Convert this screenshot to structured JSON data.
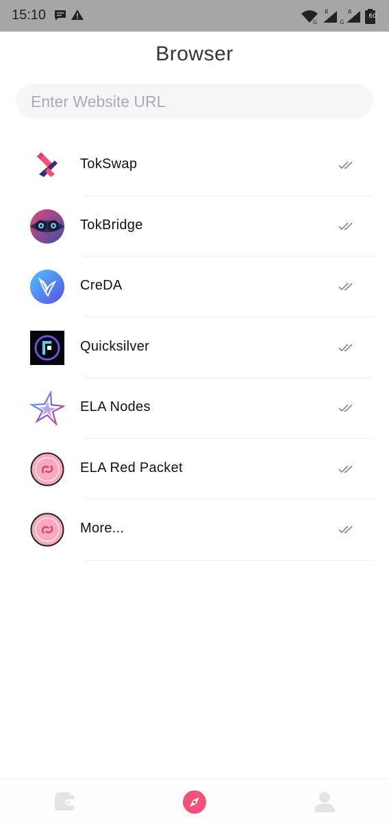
{
  "status_bar": {
    "time": "15:10",
    "battery": "60",
    "left_icons": [
      "message-icon",
      "warning-icon"
    ],
    "right_icons": [
      "wifi-icon",
      "signal-icon",
      "signal-icon",
      "battery-icon"
    ]
  },
  "header": {
    "title": "Browser"
  },
  "url_bar": {
    "value": "",
    "placeholder": "Enter Website URL"
  },
  "apps": [
    {
      "label": "TokSwap",
      "icon": "tokswap-logo-icon"
    },
    {
      "label": "TokBridge",
      "icon": "tokbridge-logo-icon"
    },
    {
      "label": "CreDA",
      "icon": "creda-logo-icon"
    },
    {
      "label": "Quicksilver",
      "icon": "quicksilver-logo-icon"
    },
    {
      "label": "ELA Nodes",
      "icon": "ela-nodes-logo-icon"
    },
    {
      "label": "ELA Red Packet",
      "icon": "ela-red-packet-logo-icon"
    },
    {
      "label": "More...",
      "icon": "more-logo-icon"
    }
  ],
  "bottom_nav": [
    {
      "name": "wallet",
      "icon": "wallet-icon",
      "active": false
    },
    {
      "name": "browser",
      "icon": "compass-icon",
      "active": true
    },
    {
      "name": "profile",
      "icon": "user-icon",
      "active": false
    }
  ],
  "colors": {
    "accent": "#f2527a",
    "status_bar": "#a6a6a6",
    "nav_inactive": "#e3e3e3"
  }
}
